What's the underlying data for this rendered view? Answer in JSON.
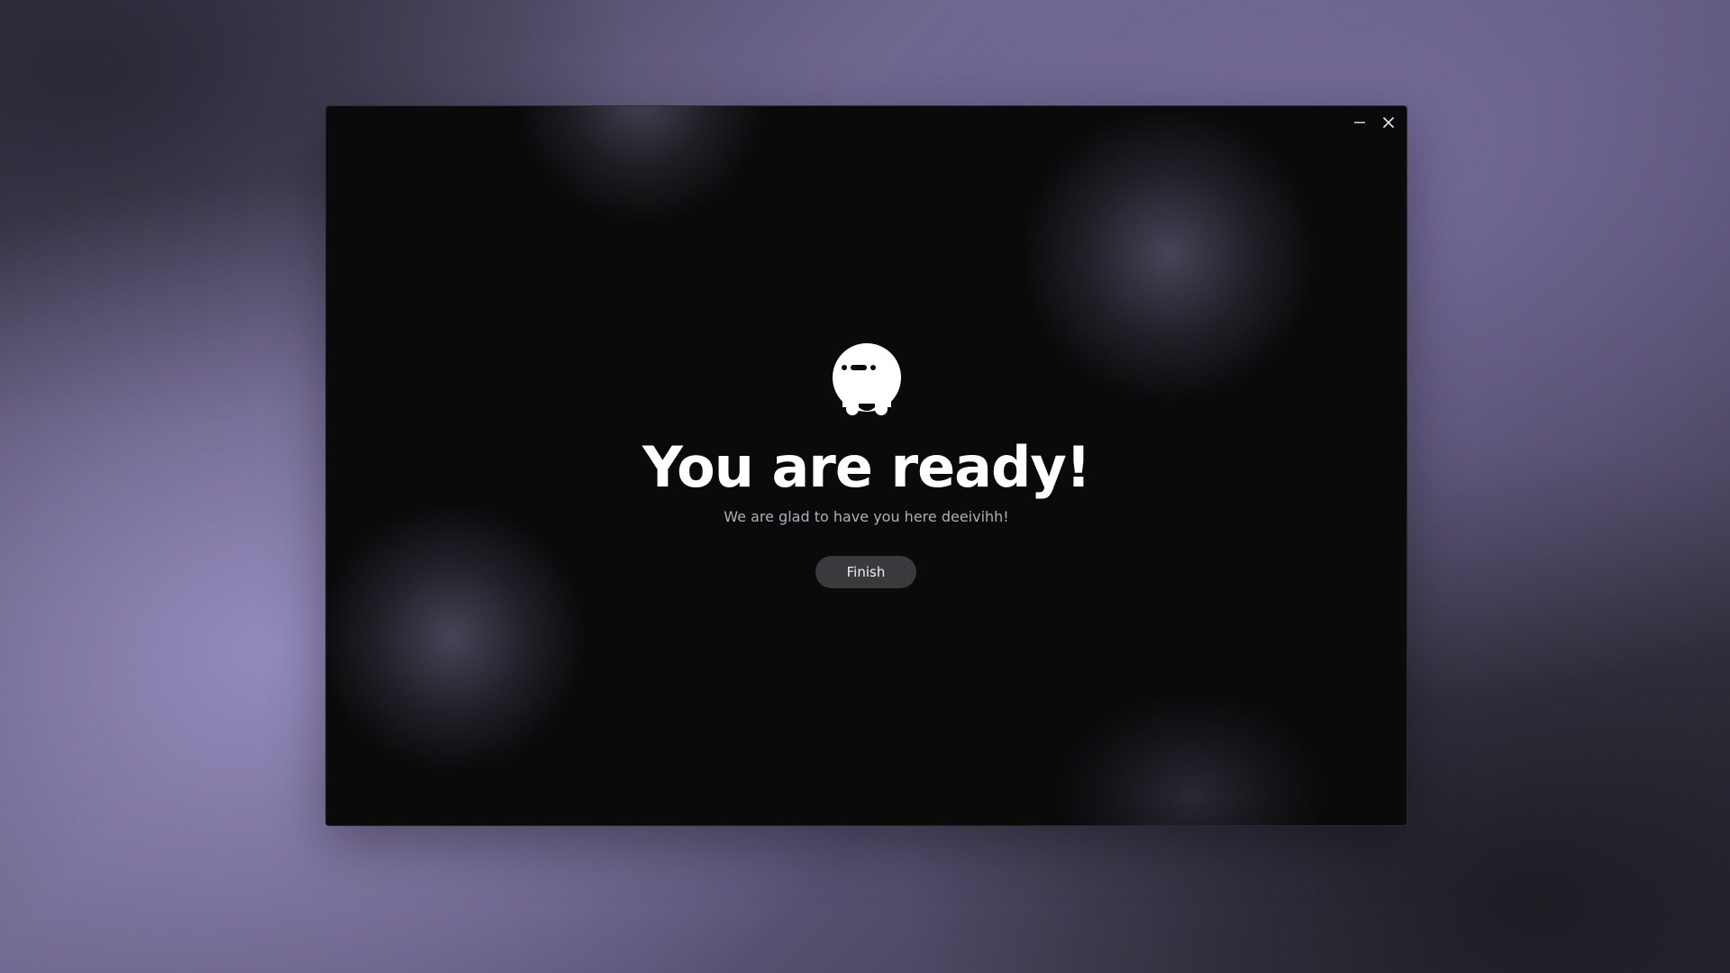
{
  "window": {
    "controls": {
      "minimize_icon": "minimize-icon",
      "close_icon": "close-icon"
    }
  },
  "main": {
    "mascot_icon": "mascot-ghost-icon",
    "title": "You are ready!",
    "subtitle": "We are glad to have you here deeivihh!",
    "finish_label": "Finish"
  },
  "colors": {
    "window_bg": "#0a0a0b",
    "title": "#ffffff",
    "subtitle": "#b0aeb6",
    "button_bg": "#3a3a3d",
    "button_text": "#f0f0f2",
    "desktop_accent": "#8c86b0"
  }
}
